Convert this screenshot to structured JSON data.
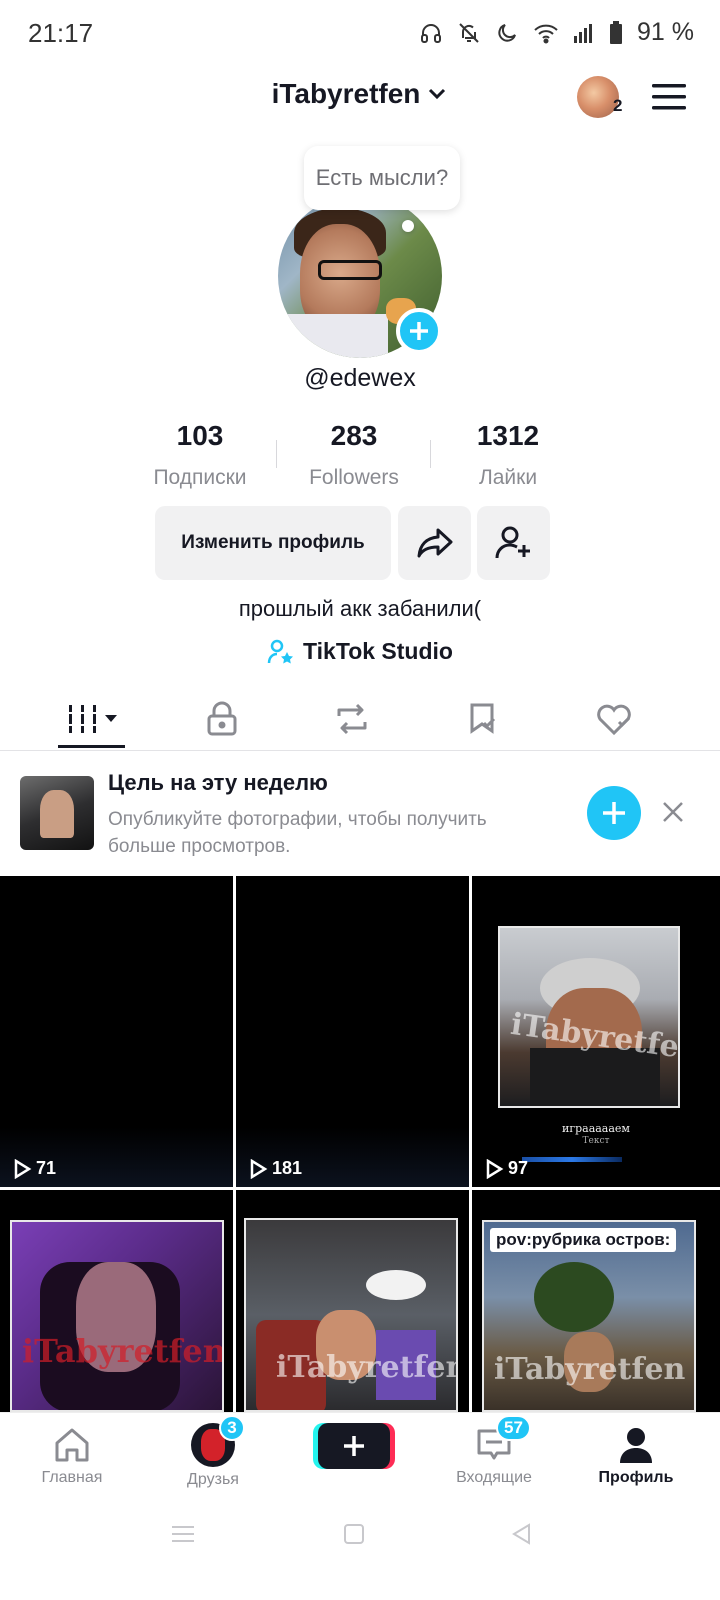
{
  "status_bar": {
    "time": "21:17",
    "battery": "91 %",
    "icons": [
      "headphones-icon",
      "bell-muted-icon",
      "moon-icon",
      "wifi-icon",
      "signal-icon",
      "battery-icon"
    ]
  },
  "header": {
    "username": "iTabyretfen",
    "account_count": "2"
  },
  "profile": {
    "thought_bubble": "Есть мысли?",
    "handle": "@edewex",
    "stats": [
      {
        "value": "103",
        "label": "Подписки"
      },
      {
        "value": "283",
        "label": "Followers"
      },
      {
        "value": "1312",
        "label": "Лайки"
      }
    ],
    "edit_label": "Изменить профиль",
    "bio": "прошлый акк забанили(",
    "studio_link": "TikTok Studio"
  },
  "tabs": [
    "grid-icon",
    "lock-icon",
    "repost-icon",
    "saved-icon",
    "liked-icon"
  ],
  "goal": {
    "title": "Цель на эту неделю",
    "description": "Опубликуйте фотографии, чтобы получить больше просмотров."
  },
  "videos": [
    {
      "views": "71"
    },
    {
      "views": "181"
    },
    {
      "views": "97",
      "overlay": "iTabyretfen",
      "caption": "играааааем",
      "sub": "Текст"
    },
    {
      "overlay": "iTabyretfen"
    },
    {
      "overlay": "iTabyretfen"
    },
    {
      "caption": "pov:рубрика остров:",
      "overlay": "iTabyretfen"
    }
  ],
  "nav": {
    "home": "Главная",
    "friends": "Друзья",
    "friends_badge": "3",
    "inbox": "Входящие",
    "inbox_badge": "57",
    "profile": "Профиль"
  },
  "colors": {
    "accent": "#20c5f6",
    "text": "#161823",
    "muted": "#8a8b91"
  }
}
